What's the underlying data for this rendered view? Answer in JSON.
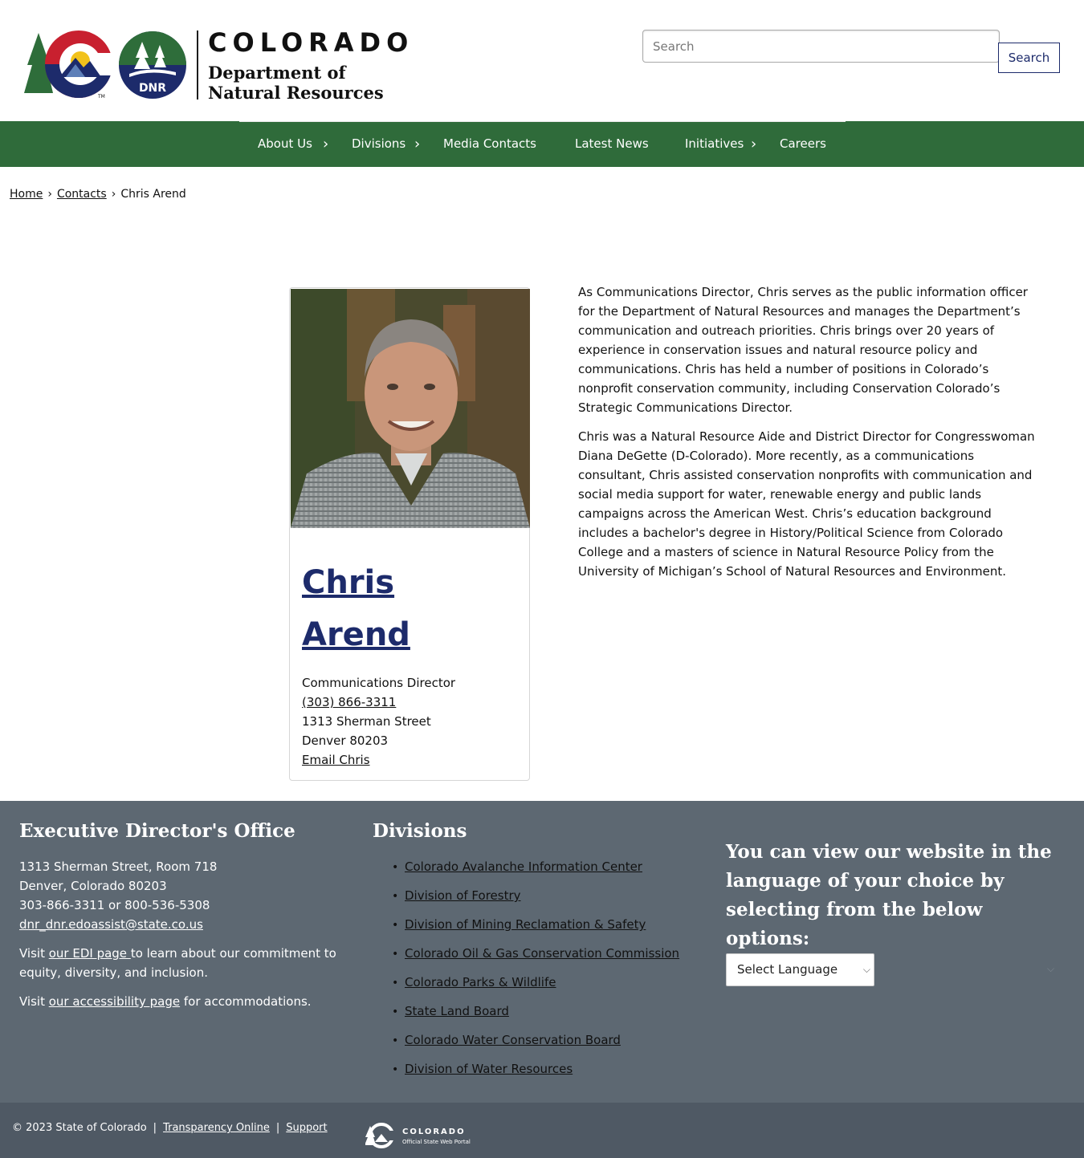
{
  "header": {
    "logo_word": "COLORADO",
    "logo_line1": "Department of",
    "logo_line2": "Natural Resources",
    "logo_badge": "DNR",
    "logo_tm": "TM",
    "search_placeholder": "Search",
    "search_button": "Search"
  },
  "nav": {
    "items": [
      {
        "label": "About Us",
        "has_submenu": true
      },
      {
        "label": "Divisions",
        "has_submenu": true
      },
      {
        "label": "Media Contacts",
        "has_submenu": false
      },
      {
        "label": "Latest News",
        "has_submenu": false
      },
      {
        "label": "Initiatives",
        "has_submenu": true
      },
      {
        "label": "Careers",
        "has_submenu": false
      }
    ],
    "chevron": "›"
  },
  "breadcrumb": {
    "items": [
      "Home",
      "Contacts",
      "Chris Arend"
    ],
    "separator": "›"
  },
  "profile": {
    "first_name": "Chris",
    "last_name": "Arend",
    "title": "Communications Director",
    "phone": "(303) 866-3311",
    "street": "1313 Sherman Street",
    "city": "Denver 80203",
    "email_link": "Email Chris"
  },
  "bio": {
    "paragraphs": [
      "As Communications Director, Chris serves as the public information officer for the Department of Natural Resources and manages the Department’s communication and outreach priorities. Chris brings over 20 years of experience in conservation issues and natural resource policy and communications. Chris has held a number of positions in Colorado’s nonprofit conservation community, including Conservation Colorado’s Strategic Communications Director.",
      "Chris was a Natural Resource Aide and District Director for Congresswoman Diana DeGette (D-Colorado). More recently, as a communications consultant, Chris assisted conservation nonprofits with communication and social media support for water, renewable energy and public lands campaigns across the American West. Chris’s education background includes a bachelor's degree in History/Political Science from Colorado College and a masters of science in Natural Resource Policy from the University of Michigan’s School of Natural Resources and Environment."
    ]
  },
  "footer": {
    "office": {
      "heading": "Executive Director's Office",
      "address1": "1313 Sherman Street, Room 718",
      "address2": "Denver, Colorado 80203",
      "phones": "303-866-3311 or 800-536-5308",
      "email": "dnr_dnr.edoassist@state.co.us",
      "edi_prefix": "Visit ",
      "edi_link": "our EDI page ",
      "edi_suffix": "to learn about our commitment to",
      "edi_suffix2": "equity, diversity, and inclusion.",
      "access_prefix": "Visit ",
      "access_link": "our accessibility page",
      "access_suffix": " for accommodations."
    },
    "divisions": {
      "heading": "Divisions",
      "items": [
        "Colorado Avalanche Information Center",
        "Division of Forestry",
        "Division of Mining Reclamation & Safety",
        "Colorado Oil & Gas Conservation Commission",
        "Colorado Parks & Wildlife",
        "State Land Board",
        "Colorado Water Conservation Board",
        "Division of Water Resources"
      ]
    },
    "language": {
      "heading": "You can view our website in the language of your choice by selecting from the below options:",
      "select_value": "Select Language"
    }
  },
  "bottom_bar": {
    "copyright": "© 2023 State of Colorado",
    "transparency": "Transparency Online",
    "support": "Support",
    "pipe": "|",
    "portal_word": "COLORADO",
    "portal_sub": "Official State Web Portal"
  },
  "colors": {
    "nav_green": "#2f6b3a",
    "link_navy": "#1d2b6b",
    "footer_gray": "#5d6872",
    "bottom_gray": "#4f5964"
  }
}
